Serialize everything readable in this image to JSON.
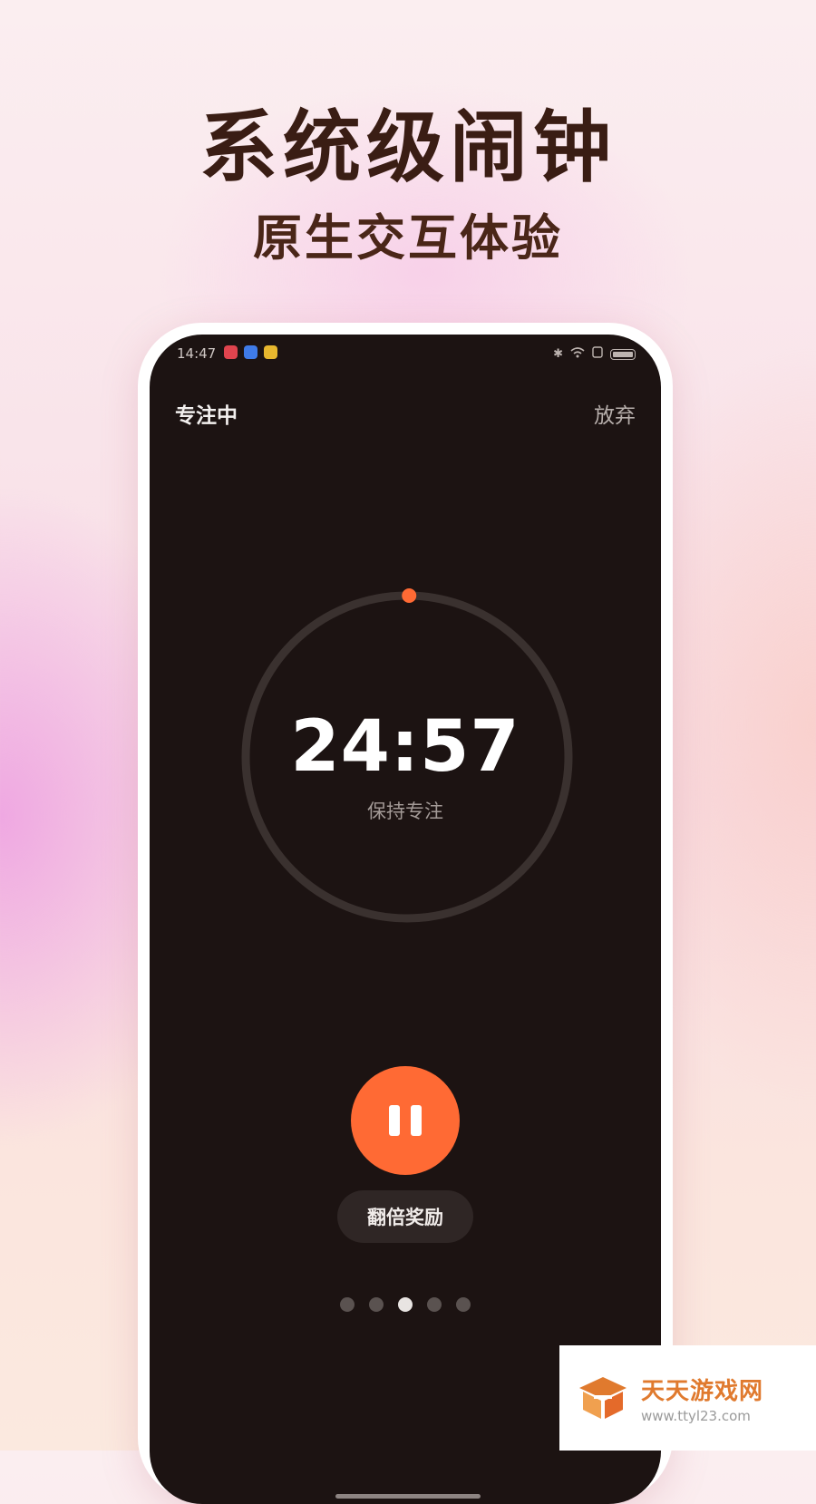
{
  "promo": {
    "headline": "系统级闹钟",
    "subheadline": "原生交互体验"
  },
  "status_bar": {
    "time": "14:47",
    "icons": [
      "bluetooth-icon",
      "wifi-icon",
      "sim-icon",
      "battery-icon"
    ]
  },
  "header": {
    "title": "专注中",
    "abandon_label": "放弃"
  },
  "timer": {
    "time_remaining": "24:57",
    "caption": "保持专注",
    "progress_fraction": 0.002,
    "ring_color": "#3a312f",
    "indicator_color": "#ff6a34"
  },
  "controls": {
    "pause_icon": "pause-icon",
    "reward_label": "翻倍奖励"
  },
  "pagination": {
    "total": 5,
    "active_index": 2
  },
  "watermark": {
    "name": "天天游戏网",
    "url": "www.ttyl23.com"
  },
  "colors": {
    "accent": "#ff6a34",
    "screen_background": "#1c1312",
    "headline_color": "#3a1d14"
  }
}
